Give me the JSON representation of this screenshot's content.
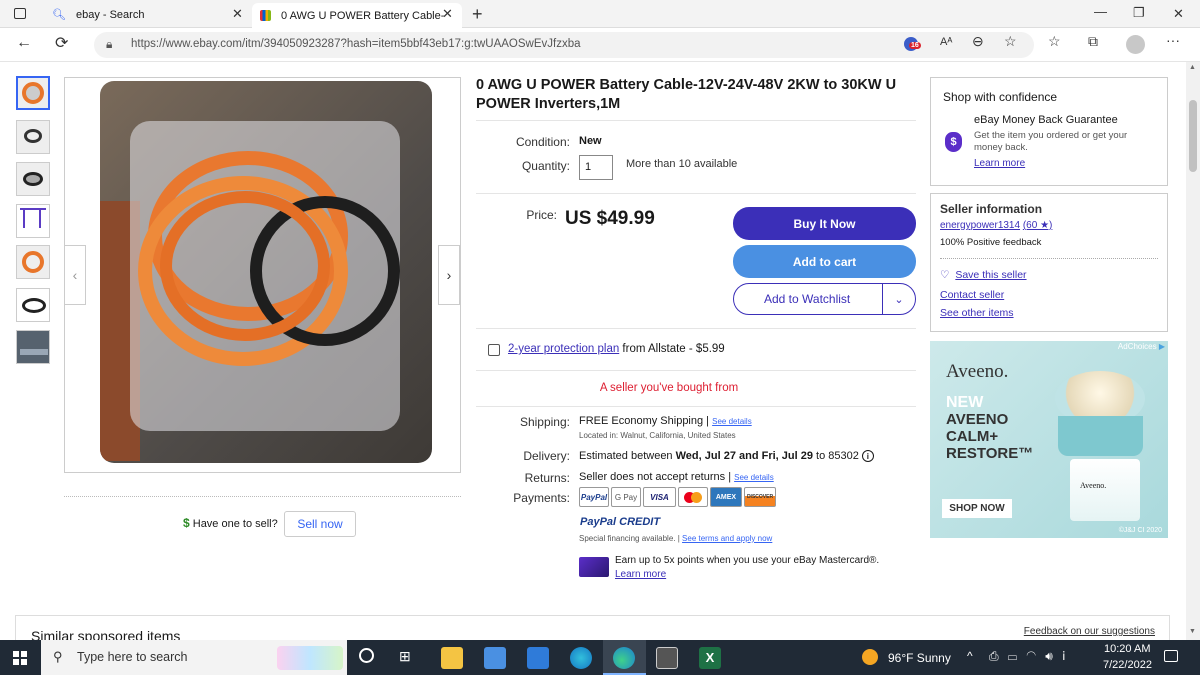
{
  "browser": {
    "tabs": [
      {
        "label": "ebay - Search",
        "icon": "search-icon"
      },
      {
        "label": "0 AWG U POWER Battery Cable-",
        "icon": "ebay-bag-icon"
      }
    ],
    "url": "https://www.ebay.com/itm/394050923287?hash=item5bbf43eb17:g:twUAAOSwEvJfzxba",
    "extension_badge": "16",
    "read_aloud": "Aᴬ"
  },
  "product": {
    "title": "0 AWG U POWER Battery Cable-12V-24V-48V 2KW to 30KW U POWER Inverters,1M",
    "condition_label": "Condition:",
    "condition_value": "New",
    "quantity_label": "Quantity:",
    "quantity_value": "1",
    "availability": "More than 10 available",
    "price_label": "Price:",
    "price": "US $49.99",
    "buy_now": "Buy It Now",
    "add_to_cart": "Add to cart",
    "add_to_watchlist": "Add to Watchlist",
    "protection_link": "2-year protection plan",
    "protection_rest": " from Allstate - $5.99",
    "seller_note": "A seller you've bought from",
    "shipping_label": "Shipping:",
    "shipping_value": "FREE Economy Shipping",
    "shipping_sep": " | ",
    "see_details": "See details",
    "located": "Located in: Walnut, California, United States",
    "delivery_label": "Delivery:",
    "delivery_pre": "Estimated between ",
    "delivery_dates": "Wed, Jul 27 and Fri, Jul 29",
    "delivery_post": " to 85302",
    "returns_label": "Returns:",
    "returns_value": "Seller does not accept returns",
    "payments_label": "Payments:",
    "payment_methods": [
      "PayPal",
      "G Pay",
      "VISA",
      "MC",
      "AMEX",
      "DISCOVER"
    ],
    "paypal_credit": "PayPal CREDIT",
    "special_financing": "Special financing available.",
    "see_terms": "See terms and apply now",
    "mastercard_line": "Earn up to 5x points when you use your eBay Mastercard®.",
    "learn_more": "Learn more"
  },
  "sell": {
    "question": "Have one to sell?",
    "button": "Sell now"
  },
  "confidence": {
    "heading": "Shop with confidence",
    "guarantee_title": "eBay Money Back Guarantee",
    "guarantee_text": "Get the item you ordered or get your money back.",
    "learn_more": "Learn more"
  },
  "seller": {
    "heading": "Seller information",
    "name": "energypower1314",
    "rating": "(60 ★)",
    "feedback": "100% Positive feedback",
    "save": "Save this seller",
    "contact": "Contact seller",
    "other_items": "See other items"
  },
  "ad": {
    "adchoices": "AdChoices",
    "brand": "Aveeno.",
    "headline": [
      "NEW",
      "AVEENO",
      "CALM+",
      "RESTORE™"
    ],
    "cta": "SHOP NOW",
    "copyright": "©J&J CI 2020",
    "jar_label": "Aveeno."
  },
  "bottom": {
    "similar": "Similar sponsored items",
    "feedback_link": "Feedback on our suggestions"
  },
  "taskbar": {
    "search_placeholder": "Type here to search",
    "weather": "96°F  Sunny",
    "time": "10:20 AM",
    "date": "7/22/2022"
  },
  "colors": {
    "ebay_blue": "#3665f3",
    "buy_now": "#3b2fb8",
    "cart": "#4a90e2",
    "red_note": "#dd1e31",
    "taskbar": "#202a36"
  }
}
